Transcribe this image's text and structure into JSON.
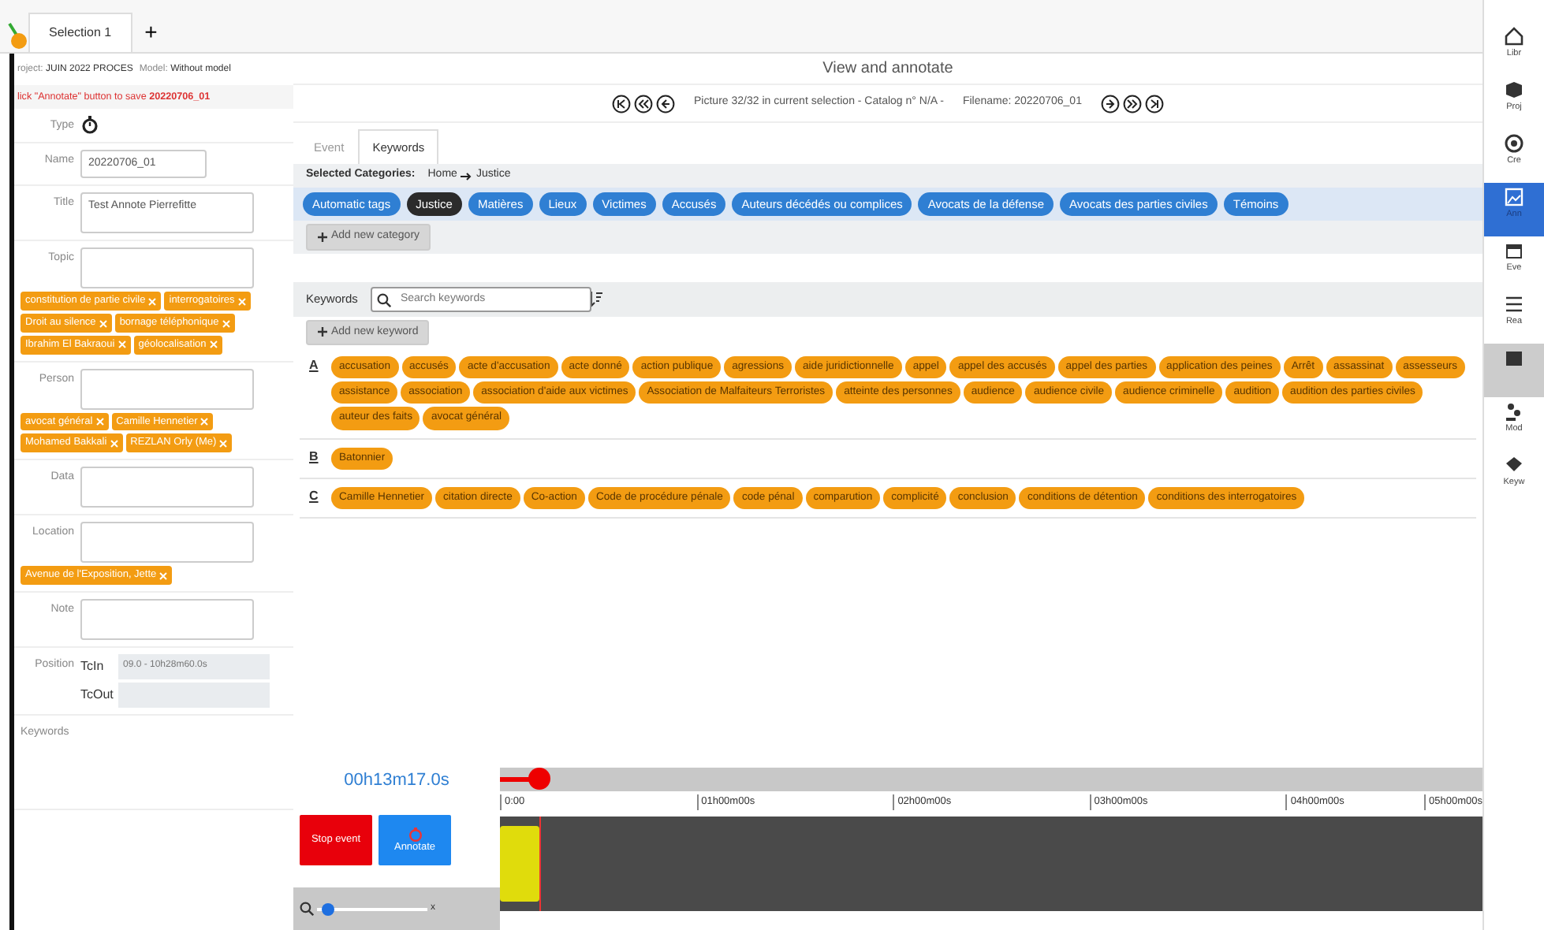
{
  "tabs": [
    {
      "label": "Selection 1",
      "selected": true
    }
  ],
  "add_tab": "+",
  "project": {
    "label": "roject:",
    "value": "JUIN 2022 PROCES",
    "model_label": "Model:",
    "model_value": "Without model"
  },
  "warning": "lick \"Annotate\" button to save **20220706_01**",
  "form": [
    {
      "kind": "type",
      "label": "Type"
    },
    {
      "kind": "input",
      "label": "Name",
      "value": "20220706_01"
    },
    {
      "kind": "textarea",
      "label": "Title",
      "value": "Test Annote Pierrefitte"
    },
    {
      "kind": "textarea",
      "label": "Topic",
      "tags": [
        "constitution de partie civile",
        "interrogatoires",
        "Droit au silence",
        "bornage téléphonique",
        "Ibrahim El Bakraoui",
        "géolocalisation"
      ]
    },
    {
      "kind": "textarea",
      "label": "Person",
      "tags": [
        "avocat général",
        "Camille Hennetier",
        "Mohamed Bakkali",
        "REZLAN Orly (Me)"
      ]
    },
    {
      "kind": "textarea",
      "label": "Data"
    },
    {
      "kind": "textarea",
      "label": "Location",
      "tags": [
        "Avenue de l'Exposition, Jette"
      ]
    },
    {
      "kind": "textarea",
      "label": "Note"
    },
    {
      "kind": "position",
      "label": "Position",
      "tcin_label": "TcIn",
      "tcin": "09.0 - 10h28m60.0s",
      "tcout_label": "TcOut"
    },
    {
      "kind": "section",
      "label": "Keywords"
    }
  ],
  "header": {
    "title": "View and annotate",
    "picture_info": "Picture 32/32 in current selection - Catalog n° N/A -",
    "filename": "Filename: 20220706_01"
  },
  "panel_tabs": [
    {
      "label": "Event",
      "selected": false
    },
    {
      "label": "Keywords",
      "selected": true
    }
  ],
  "categories": {
    "label": "Selected Categories:",
    "breadcrumb": [
      "Home",
      "Justice"
    ],
    "chips": [
      {
        "label": "Automatic tags",
        "selected": false
      },
      {
        "label": "Justice",
        "selected": true
      },
      {
        "label": "Matières",
        "selected": false
      },
      {
        "label": "Lieux",
        "selected": false
      },
      {
        "label": "Victimes",
        "selected": false
      },
      {
        "label": "Accusés",
        "selected": false
      },
      {
        "label": "Auteurs décédés ou complices",
        "selected": false
      },
      {
        "label": "Avocats de la défense",
        "selected": false
      },
      {
        "label": "Avocats des parties civiles",
        "selected": false
      },
      {
        "label": "Témoins",
        "selected": false
      }
    ],
    "add_button": "Add new category"
  },
  "keywords": {
    "label": "Keywords",
    "search_placeholder": "Search keywords",
    "add_button": "Add new keyword",
    "groups": [
      {
        "letter": "A",
        "items": [
          "accusation",
          "accusés",
          "acte d'accusation",
          "acte donné",
          "action publique",
          "agressions",
          "aide juridictionnelle",
          "appel",
          "appel des accusés",
          "appel des parties",
          "application des peines",
          "Arrêt",
          "assassinat",
          "assesseurs",
          "assistance",
          "association",
          "association d'aide aux victimes",
          "Association de Malfaiteurs Terroristes",
          "atteinte des personnes",
          "audience",
          "audience civile",
          "audience criminelle",
          "audition",
          "audition des parties civiles",
          "auteur des faits",
          "avocat général"
        ]
      },
      {
        "letter": "B",
        "items": [
          "Batonnier"
        ]
      },
      {
        "letter": "C",
        "items": [
          "Camille Hennetier",
          "citation directe",
          "Co-action",
          "Code de procédure pénale",
          "code pénal",
          "comparution",
          "complicité",
          "conclusion",
          "conditions de détention",
          "conditions des interrogatoires"
        ]
      }
    ]
  },
  "timeline": {
    "time": "00h13m17.0s",
    "stop_button": "Stop event",
    "annotate_button": "Annotate",
    "zoom": {
      "level": 0.05
    },
    "zoom_close": "x",
    "playhead": {
      "level": 0.04
    },
    "ticks": [
      "0:00",
      "01h00m00s",
      "02h00m00s",
      "03h00m00s",
      "04h00m00s",
      "05h00m00s"
    ]
  },
  "sidebar": [
    {
      "label": "Libr",
      "selected": false
    },
    {
      "label": "Proj",
      "selected": false
    },
    {
      "label": "Cre",
      "selected": false
    },
    {
      "label": "Ann",
      "selected": true
    },
    {
      "label": "Eve",
      "selected": false
    },
    {
      "label": "Rea",
      "selected": false
    },
    {
      "selected": false,
      "hover": true
    },
    {
      "label": "Mod",
      "selected": false
    },
    {
      "label": "Keyw",
      "selected": false
    }
  ]
}
